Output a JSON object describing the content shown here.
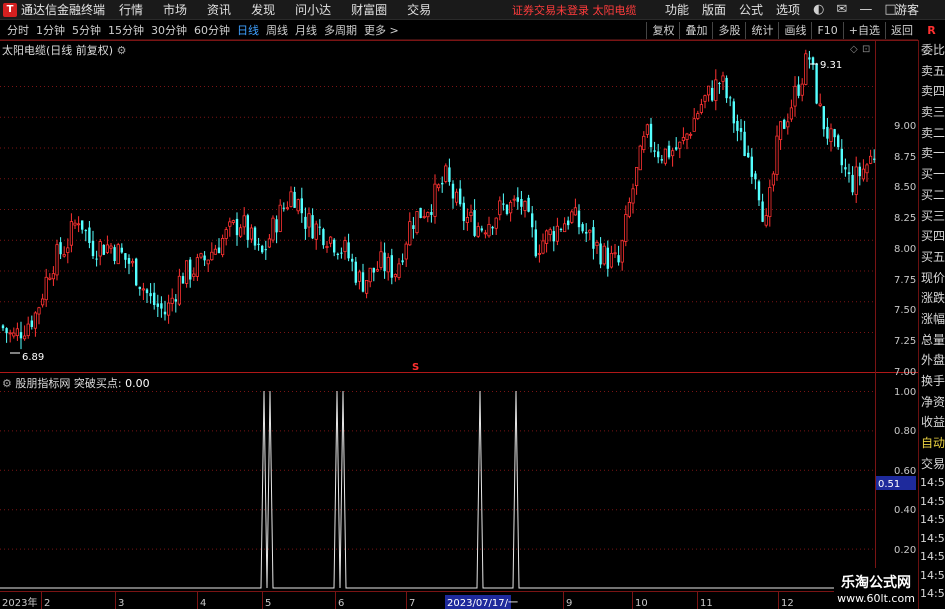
{
  "titlebar": {
    "app_title": "通达信金融终端",
    "menus": [
      "行情",
      "市场",
      "资讯",
      "发现",
      "问小达",
      "财富圈",
      "交易"
    ],
    "notice": "证券交易未登录  太阳电缆",
    "right_menus": [
      "功能",
      "版面",
      "公式",
      "选项"
    ],
    "guest": "游客"
  },
  "toolbar": {
    "periods": [
      "分时",
      "1分钟",
      "5分钟",
      "15分钟",
      "30分钟",
      "60分钟",
      "日线",
      "周线",
      "月线",
      "多周期",
      "更多 >"
    ],
    "active_period": "日线",
    "tools": [
      "复权",
      "叠加",
      "多股",
      "统计",
      "画线",
      "F10",
      "+自选",
      "返回"
    ],
    "r_badge": "R"
  },
  "main_chart": {
    "label": "太阳电缆(日线 前复权)",
    "price_axis": [
      "9.00",
      "8.75",
      "8.50",
      "8.25",
      "8.00",
      "7.75",
      "7.50",
      "7.25",
      "7.00"
    ],
    "high_label": "9.31",
    "low_label": "6.89",
    "marker": "S"
  },
  "indicator": {
    "label": "股朋指标网 突破买点:",
    "value": "0.00",
    "axis": [
      "1.00",
      "0.80",
      "0.60",
      "0.40",
      "0.20"
    ],
    "current_value": "0.51"
  },
  "date_axis": {
    "labels": [
      "2023年",
      "2",
      "3",
      "4",
      "5",
      "6",
      "7",
      "8",
      "9",
      "10",
      "11",
      "12"
    ],
    "highlight": "2023/07/17/一"
  },
  "side_panel": {
    "items": [
      "委比",
      "卖五",
      "卖四",
      "卖三",
      "卖二",
      "卖一",
      "买一",
      "买二",
      "买三",
      "买四",
      "买五",
      "现价",
      "涨跌",
      "涨幅",
      "总量",
      "外盘",
      "换手",
      "净资",
      "收益"
    ],
    "extra": [
      "自动",
      "交易"
    ],
    "times": [
      "14:56",
      "14:56",
      "14:56",
      "14:56",
      "14:56",
      "14:56",
      "14:56",
      "14:56",
      "14:56",
      "14:56"
    ]
  },
  "watermark": {
    "title": "乐淘公式网",
    "url": "www.60lt.com"
  },
  "colors": {
    "up": "#ff3232",
    "down": "#54ffff",
    "grid": "#7a1414",
    "axis_text": "#c8c8c8",
    "highlight_bg": "#1e2a9c"
  },
  "chart_data": {
    "type": "candlestick",
    "price_range": [
      6.89,
      9.31
    ],
    "indicator_type": "line",
    "indicator_range": [
      0,
      1
    ],
    "indicator_spikes": [
      "2023/05",
      "2023/06",
      "2023/08",
      "2023/09"
    ]
  }
}
